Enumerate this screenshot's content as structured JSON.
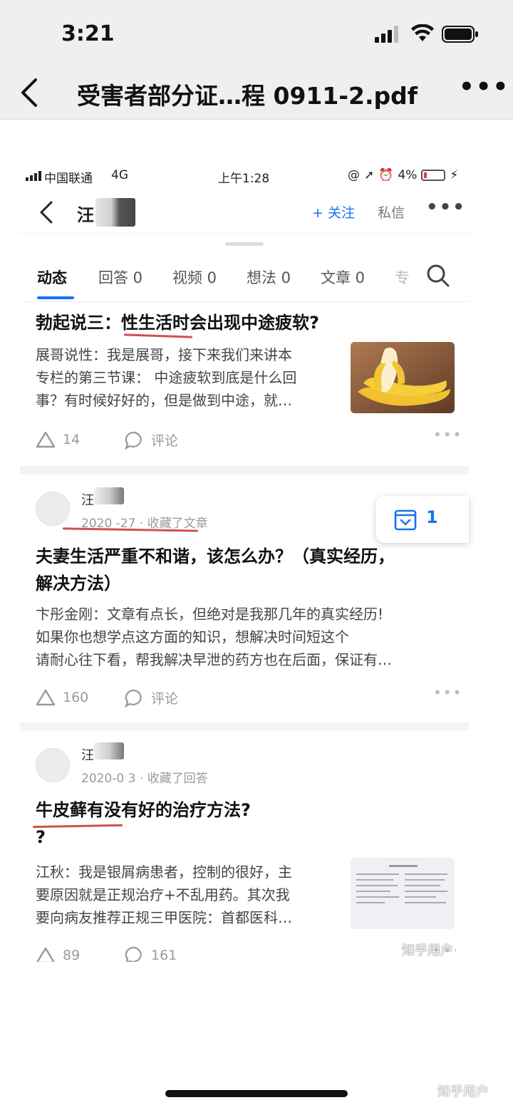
{
  "ios_status": {
    "time": "3:21"
  },
  "pdf_nav": {
    "title": "受害者部分证…程 0911-2.pdf",
    "more": "•••"
  },
  "inner_status": {
    "carrier": "中国联通",
    "network": "4G",
    "time": "上午1:28",
    "battery": "4%"
  },
  "inner_header": {
    "name": "汪",
    "follow": "+ 关注",
    "message": "私信",
    "more": "•••"
  },
  "tabs": [
    "动态",
    "回答 0",
    "视频 0",
    "想法 0",
    "文章 0",
    "专"
  ],
  "feed": [
    {
      "title": "勃起说三：性生活时会出现中途疲软?",
      "excerpt": [
        "展哥说性：我是展哥，接下来我们来讲本",
        "专栏的第三节课： 中途疲软到底是什么回",
        "事？有时候好好的，但是做到中途，就…"
      ],
      "likes": "14",
      "comment_label": "评论",
      "thumb_icon": "banana-image"
    },
    {
      "user": "汪",
      "meta": "2020 -27 · 收藏了文章",
      "title": [
        "夫妻生活严重不和谐，该怎么办？（真实经历，",
        "解决方法）"
      ],
      "excerpt": [
        "卞彤金刚：文章有点长，但绝对是我那几年的真实经历!",
        "如果你也想学点这方面的知识，想解决时间短这个",
        "请耐心往下看，帮我解决早泄的药方也在后面，保证有…"
      ],
      "likes": "160",
      "comment_label": "评论"
    },
    {
      "user": "汪",
      "meta": "2020-0 3 · 收藏了回答",
      "title": [
        "牛皮藓有没有好的治疗方法?",
        "?"
      ],
      "excerpt": [
        "江秋：我是银屑病患者，控制的很好，主",
        "要原因就是正规治疗+不乱用药。其次我",
        "要向病友推荐正规三甲医院：首都医科…"
      ],
      "likes": "89",
      "comments": "161",
      "thumb_icon": "document-image"
    }
  ],
  "floating_badge": "1",
  "watermark_inner": "知乎用户",
  "watermark_outer": "知乎用户",
  "colors": {
    "accent": "#1772f6",
    "annotation": "#c8312b"
  }
}
